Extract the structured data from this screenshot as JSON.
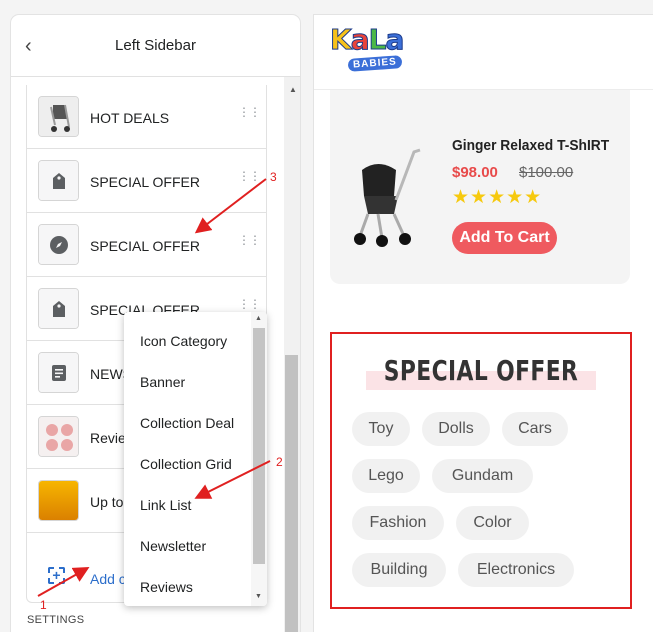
{
  "left_panel": {
    "title": "Left Sidebar",
    "back_icon": "chevron-left-icon",
    "items": [
      {
        "label": "HOT DEALS",
        "thumb": "stroller-image"
      },
      {
        "label": "SPECIAL OFFER",
        "thumb": "tag-icon"
      },
      {
        "label": "SPECIAL OFFER",
        "thumb": "compass-icon"
      },
      {
        "label": "SPECIAL OFFER",
        "thumb": "tag-icon"
      },
      {
        "label": "NEWS",
        "thumb": "document-icon"
      },
      {
        "label": "Revie",
        "thumb": "reviews-image"
      },
      {
        "label": "Up to",
        "thumb": "promo-image"
      }
    ],
    "add_label": "Add c",
    "settings_label": "SETTINGS"
  },
  "dropdown": {
    "options": [
      "Icon Category",
      "Banner",
      "Collection Deal",
      "Collection Grid",
      "Link List",
      "Newsletter",
      "Reviews"
    ]
  },
  "annotations": {
    "one": "1",
    "two": "2",
    "three": "3",
    "color": "#e02020"
  },
  "right_panel": {
    "logo": {
      "top": "KaLa",
      "bottom": "BABIES"
    },
    "product": {
      "name": "Ginger Relaxed T-ShIRT",
      "price": "$98.00",
      "old_price": "$100.00",
      "stars": "★★★★★",
      "cart_label": "Add To Cart"
    },
    "offer": {
      "title": "SPECIAL OFFER",
      "tags": [
        "Toy",
        "Dolls",
        "Cars",
        "Lego",
        "Gundam",
        "Fashion",
        "Color",
        "Building",
        "Electronics"
      ]
    }
  }
}
